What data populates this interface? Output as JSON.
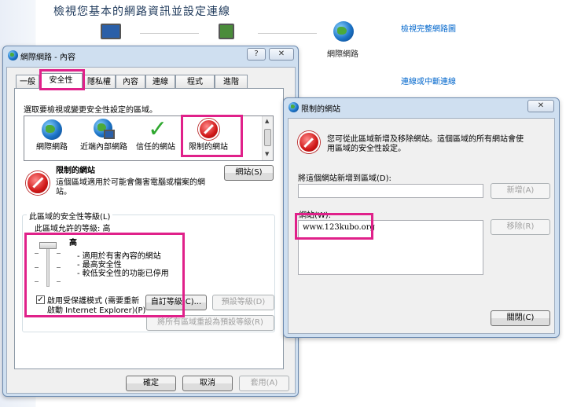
{
  "background": {
    "title": "檢視您基本的網路資訊並設定連線",
    "link_full_map": "檢視完整網路圖",
    "link_connect": "連線或中斷連線",
    "internet_label": "網際網路"
  },
  "props_dialog": {
    "title": "網際網路 - 內容",
    "help_btn": "?",
    "close_btn": "✕",
    "tabs": [
      "一般",
      "安全性",
      "隱私權",
      "內容",
      "連線",
      "程式",
      "進階"
    ],
    "select_zone_text": "選取要檢視或變更安全性設定的區域。",
    "zones": [
      "網際網路",
      "近端內部網路",
      "信任的網站",
      "限制的網站"
    ],
    "zone_name": "限制的網站",
    "zone_desc_line1": "這個區域適用於可能會傷害電腦或檔案的網",
    "zone_desc_line2": "站。",
    "sites_button": "網站(S)",
    "security_level_label": "此區域的安全性等級(L)",
    "allowed_level": "此區域允許的等級: 高",
    "level_name": "高",
    "level_bullets": [
      "- 適用於有害內容的網站",
      "- 最高安全性",
      "- 較低安全性的功能已停用"
    ],
    "protected_mode_line1": "啟用受保護模式 (需要重新",
    "protected_mode_line2": "啟動 Internet Explorer)(P)",
    "protected_mode_checked": "✓",
    "custom_level_btn": "自訂等級(C)...",
    "default_level_btn": "預設等級(D)",
    "reset_all_btn": "將所有區域重設為預設等級(R)",
    "ok_btn": "確定",
    "cancel_btn": "取消",
    "apply_btn": "套用(A)"
  },
  "restricted_dialog": {
    "title": "限制的網站",
    "close_btn": "✕",
    "info_line1": "您可從此區域新增及移除網站。這個區域的所有網站會使",
    "info_line2": "用區域的安全性設定。",
    "add_label": "將這個網站新增到區域(D):",
    "add_input_value": "",
    "add_btn": "新增(A)",
    "websites_label": "網站(W):",
    "websites": [
      "www.123kubo.org"
    ],
    "remove_btn": "移除(R)",
    "close_dialog_btn": "關閉(C)"
  }
}
